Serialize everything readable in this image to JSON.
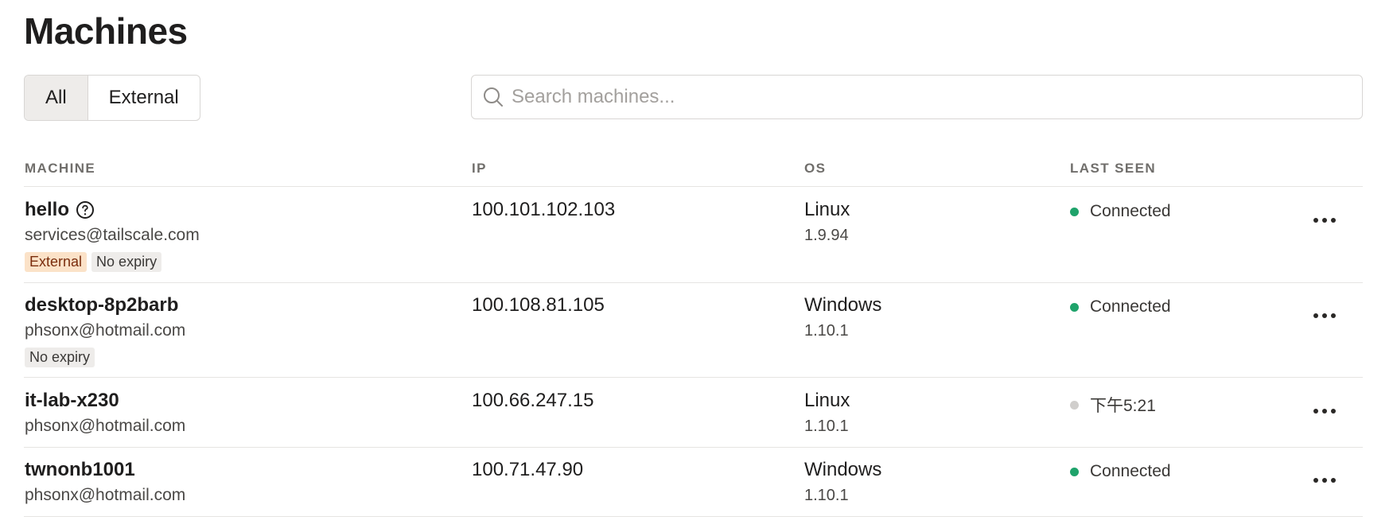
{
  "page": {
    "title": "Machines"
  },
  "filters": [
    {
      "label": "All",
      "active": true
    },
    {
      "label": "External",
      "active": false
    }
  ],
  "search": {
    "placeholder": "Search machines...",
    "value": ""
  },
  "table": {
    "headers": {
      "machine": "MACHINE",
      "ip": "IP",
      "os": "OS",
      "last_seen": "LAST SEEN"
    },
    "rows": [
      {
        "name": "hello",
        "help_icon": "question-circle-icon",
        "owner": "services@tailscale.com",
        "tags": [
          "External",
          "No expiry"
        ],
        "ip": "100.101.102.103",
        "os": "Linux",
        "version": "1.9.94",
        "last_seen": "Connected",
        "status_color": "#1fa36b"
      },
      {
        "name": "desktop-8p2barb",
        "owner": "phsonx@hotmail.com",
        "tags": [
          "No expiry"
        ],
        "ip": "100.108.81.105",
        "os": "Windows",
        "version": "1.10.1",
        "last_seen": "Connected",
        "status_color": "#1fa36b"
      },
      {
        "name": "it-lab-x230",
        "owner": "phsonx@hotmail.com",
        "tags": [],
        "ip": "100.66.247.15",
        "os": "Linux",
        "version": "1.10.1",
        "last_seen": "下午5:21",
        "status_color": "#d0cecc"
      },
      {
        "name": "twnonb1001",
        "owner": "phsonx@hotmail.com",
        "tags": [],
        "ip": "100.71.47.90",
        "os": "Windows",
        "version": "1.10.1",
        "last_seen": "Connected",
        "status_color": "#1fa36b"
      }
    ]
  },
  "colors": {
    "connected": "#1fa36b",
    "offline": "#d0cecc",
    "external_tag_bg": "#fbe2c8",
    "external_tag_text": "#7a2d0d"
  }
}
